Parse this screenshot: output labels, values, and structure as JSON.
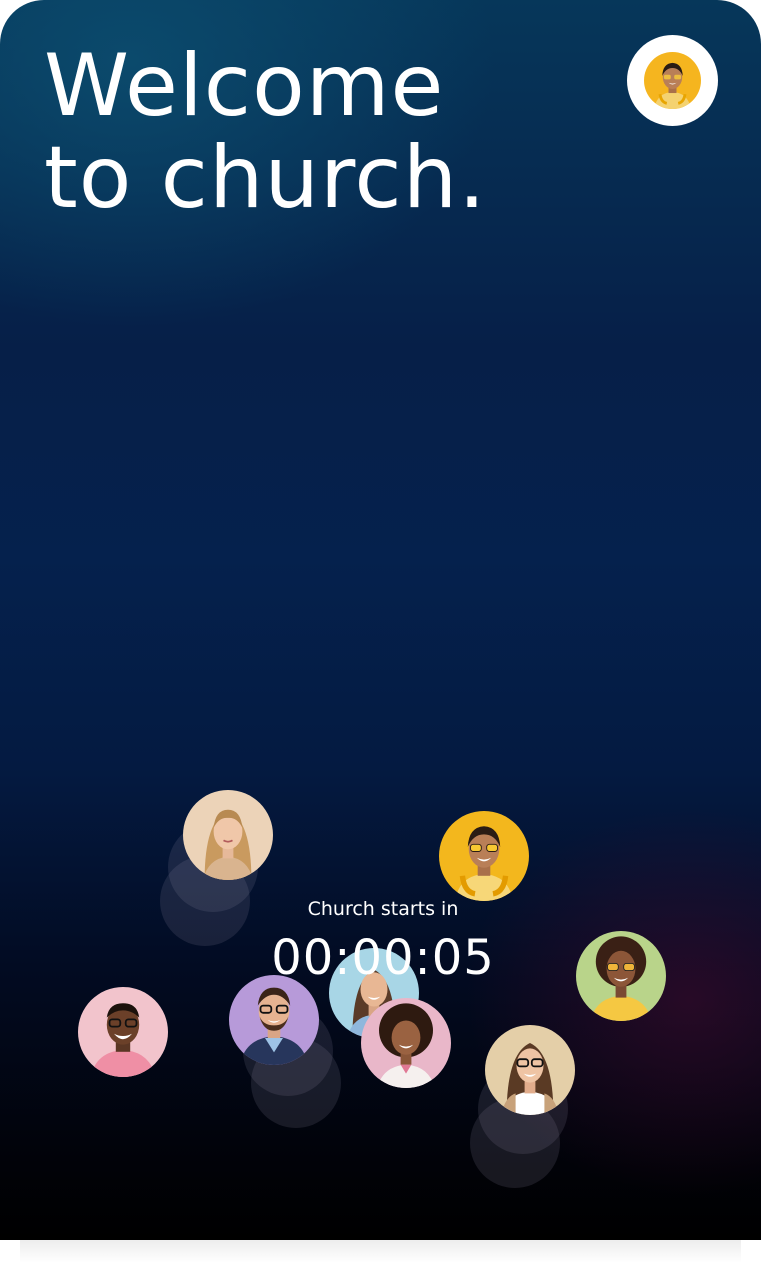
{
  "title": {
    "line1": "Welcome",
    "line2": "to church."
  },
  "profile": {
    "icon": "user-avatar-icon",
    "bg": "#f5b51f"
  },
  "countdown": {
    "label": "Church starts in",
    "time": "00:00:05"
  },
  "attendees": [
    {
      "icon": "woman-blonde-avatar",
      "bg": "#ecd3b8"
    },
    {
      "icon": "woman-yellow-glasses-avatar",
      "bg": "#f3b71d"
    },
    {
      "icon": "man-glasses-pink-shirt-avatar",
      "bg": "#f2c4cc"
    },
    {
      "icon": "man-glasses-purple-avatar",
      "bg": "#b79ad9"
    },
    {
      "icon": "woman-light-blue-avatar",
      "bg": "#a8d6e6"
    },
    {
      "icon": "woman-curly-hair-avatar",
      "bg": "#e9b7c9"
    },
    {
      "icon": "woman-sunglasses-green-avatar",
      "bg": "#b9d48a"
    },
    {
      "icon": "woman-glasses-beige-avatar",
      "bg": "#e4cfa8"
    }
  ],
  "colors": {
    "text": "#ffffff",
    "bg_top": "#06375a",
    "bg_mid": "#05214d",
    "bg_bottom": "#000000"
  }
}
